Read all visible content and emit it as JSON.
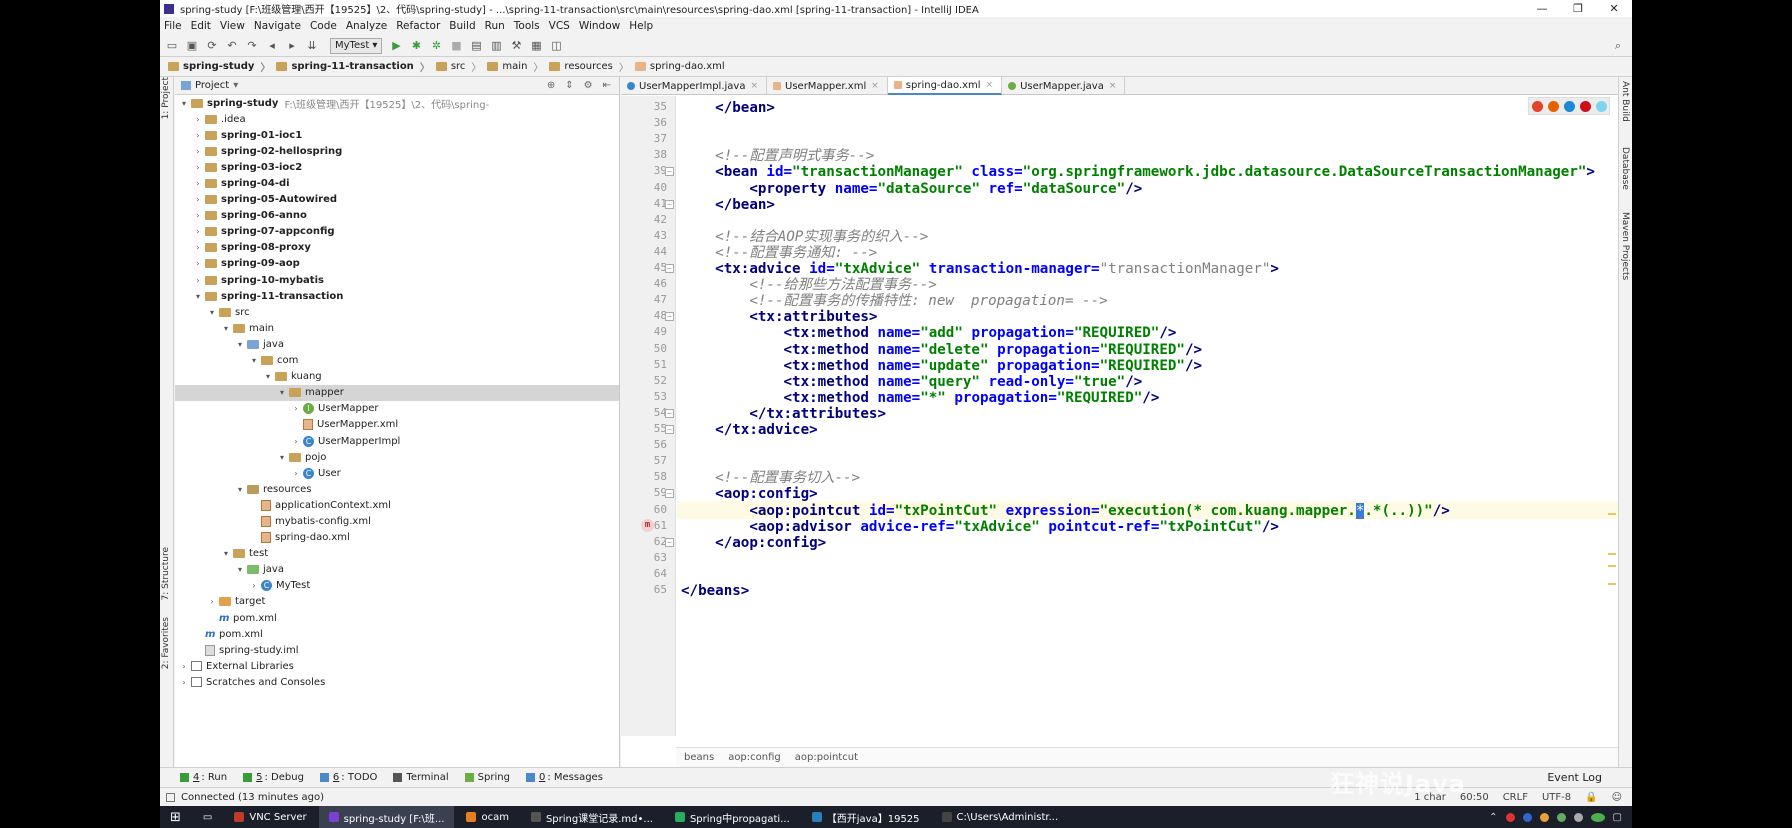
{
  "window": {
    "title": "spring-study [F:\\班级管理\\西开【19525】\\2、代码\\spring-study] - ...\\spring-11-transaction\\src\\main\\resources\\spring-dao.xml [spring-11-transaction] - IntelliJ IDEA",
    "minimize": "—",
    "maximize": "❐",
    "close": "✕"
  },
  "menu": [
    "File",
    "Edit",
    "View",
    "Navigate",
    "Code",
    "Analyze",
    "Refactor",
    "Build",
    "Run",
    "Tools",
    "VCS",
    "Window",
    "Help"
  ],
  "toolbar": {
    "run_config": "MyTest ▾"
  },
  "navbar": [
    "spring-study",
    "spring-11-transaction",
    "src",
    "main",
    "resources",
    "spring-dao.xml"
  ],
  "project": {
    "header": "Project",
    "tree": [
      {
        "label": "spring-study",
        "hint": "F:\\班级管理\\西开【19525】\\2、代码\\spring-",
        "depth": 0,
        "arrow": "open",
        "icon": "folder",
        "bold": true
      },
      {
        "label": ".idea",
        "depth": 1,
        "arrow": "closed",
        "icon": "folder"
      },
      {
        "label": "spring-01-ioc1",
        "depth": 1,
        "arrow": "closed",
        "icon": "folder",
        "bold": true
      },
      {
        "label": "spring-02-hellospring",
        "depth": 1,
        "arrow": "closed",
        "icon": "folder",
        "bold": true
      },
      {
        "label": "spring-03-ioc2",
        "depth": 1,
        "arrow": "closed",
        "icon": "folder",
        "bold": true
      },
      {
        "label": "spring-04-di",
        "depth": 1,
        "arrow": "closed",
        "icon": "folder",
        "bold": true
      },
      {
        "label": "spring-05-Autowired",
        "depth": 1,
        "arrow": "closed",
        "icon": "folder",
        "bold": true
      },
      {
        "label": "spring-06-anno",
        "depth": 1,
        "arrow": "closed",
        "icon": "folder",
        "bold": true
      },
      {
        "label": "spring-07-appconfig",
        "depth": 1,
        "arrow": "closed",
        "icon": "folder",
        "bold": true
      },
      {
        "label": "spring-08-proxy",
        "depth": 1,
        "arrow": "closed",
        "icon": "folder",
        "bold": true
      },
      {
        "label": "spring-09-aop",
        "depth": 1,
        "arrow": "closed",
        "icon": "folder",
        "bold": true
      },
      {
        "label": "spring-10-mybatis",
        "depth": 1,
        "arrow": "closed",
        "icon": "folder",
        "bold": true
      },
      {
        "label": "spring-11-transaction",
        "depth": 1,
        "arrow": "open",
        "icon": "folder",
        "bold": true
      },
      {
        "label": "src",
        "depth": 2,
        "arrow": "open",
        "icon": "folder"
      },
      {
        "label": "main",
        "depth": 3,
        "arrow": "open",
        "icon": "folder"
      },
      {
        "label": "java",
        "depth": 4,
        "arrow": "open",
        "icon": "src"
      },
      {
        "label": "com",
        "depth": 5,
        "arrow": "open",
        "icon": "folder"
      },
      {
        "label": "kuang",
        "depth": 6,
        "arrow": "open",
        "icon": "folder"
      },
      {
        "label": "mapper",
        "depth": 7,
        "arrow": "open",
        "icon": "folder",
        "selected": true
      },
      {
        "label": "UserMapper",
        "depth": 8,
        "arrow": "closed",
        "icon": "interface"
      },
      {
        "label": "UserMapper.xml",
        "depth": 8,
        "arrow": "none",
        "icon": "xml"
      },
      {
        "label": "UserMapperImpl",
        "depth": 8,
        "arrow": "closed",
        "icon": "class"
      },
      {
        "label": "pojo",
        "depth": 7,
        "arrow": "open",
        "icon": "folder"
      },
      {
        "label": "User",
        "depth": 8,
        "arrow": "closed",
        "icon": "class"
      },
      {
        "label": "resources",
        "depth": 4,
        "arrow": "open",
        "icon": "res"
      },
      {
        "label": "applicationContext.xml",
        "depth": 5,
        "arrow": "none",
        "icon": "xml"
      },
      {
        "label": "mybatis-config.xml",
        "depth": 5,
        "arrow": "none",
        "icon": "xml"
      },
      {
        "label": "spring-dao.xml",
        "depth": 5,
        "arrow": "none",
        "icon": "xml"
      },
      {
        "label": "test",
        "depth": 3,
        "arrow": "open",
        "icon": "folder"
      },
      {
        "label": "java",
        "depth": 4,
        "arrow": "open",
        "icon": "test"
      },
      {
        "label": "MyTest",
        "depth": 5,
        "arrow": "closed",
        "icon": "class"
      },
      {
        "label": "target",
        "depth": 2,
        "arrow": "closed",
        "icon": "target"
      },
      {
        "label": "pom.xml",
        "depth": 2,
        "arrow": "none",
        "icon": "maven"
      },
      {
        "label": "pom.xml",
        "depth": 1,
        "arrow": "none",
        "icon": "maven"
      },
      {
        "label": "spring-study.iml",
        "depth": 1,
        "arrow": "none",
        "icon": "file"
      },
      {
        "label": "External Libraries",
        "depth": 0,
        "arrow": "closed",
        "icon": "lib"
      },
      {
        "label": "Scratches and Consoles",
        "depth": 0,
        "arrow": "closed",
        "icon": "lib"
      }
    ]
  },
  "tabs": [
    {
      "label": "UserMapperImpl.java",
      "icon": "class",
      "active": false
    },
    {
      "label": "UserMapper.xml",
      "icon": "xml",
      "active": false
    },
    {
      "label": "spring-dao.xml",
      "icon": "xml",
      "active": true
    },
    {
      "label": "UserMapper.java",
      "icon": "interface",
      "active": false
    }
  ],
  "code": [
    {
      "n": 35,
      "t": [
        [
          "plain",
          "    "
        ],
        [
          "tag",
          "</bean>"
        ]
      ]
    },
    {
      "n": 36,
      "t": []
    },
    {
      "n": 37,
      "t": []
    },
    {
      "n": 38,
      "t": [
        [
          "plain",
          "    "
        ],
        [
          "cmt",
          "<!--配置声明式事务-->"
        ]
      ]
    },
    {
      "n": 39,
      "t": [
        [
          "plain",
          "    "
        ],
        [
          "tag",
          "<bean "
        ],
        [
          "attr",
          "id="
        ],
        [
          "val",
          "\"transactionManager\" "
        ],
        [
          "attr",
          "class="
        ],
        [
          "val",
          "\"org.springframework.jdbc.datasource.DataSourceTransactionManager\""
        ],
        [
          "tag",
          ">"
        ]
      ]
    },
    {
      "n": 40,
      "t": [
        [
          "plain",
          "        "
        ],
        [
          "tag",
          "<property "
        ],
        [
          "attr",
          "name="
        ],
        [
          "val",
          "\"dataSource\" "
        ],
        [
          "attr",
          "ref="
        ],
        [
          "val",
          "\"dataSource\""
        ],
        [
          "tag",
          "/>"
        ]
      ]
    },
    {
      "n": 41,
      "t": [
        [
          "plain",
          "    "
        ],
        [
          "tag",
          "</bean>"
        ]
      ]
    },
    {
      "n": 42,
      "t": []
    },
    {
      "n": 43,
      "t": [
        [
          "plain",
          "    "
        ],
        [
          "cmt",
          "<!--结合AOP实现事务的织入-->"
        ]
      ]
    },
    {
      "n": 44,
      "t": [
        [
          "plain",
          "    "
        ],
        [
          "cmt",
          "<!--配置事务通知: -->"
        ]
      ]
    },
    {
      "n": 45,
      "t": [
        [
          "plain",
          "    "
        ],
        [
          "tag",
          "<tx:advice "
        ],
        [
          "attr",
          "id="
        ],
        [
          "val",
          "\"txAdvice\" "
        ],
        [
          "attr",
          "transaction-manager="
        ],
        [
          "val2",
          "\"transactionManager\""
        ],
        [
          "tag",
          ">"
        ]
      ]
    },
    {
      "n": 46,
      "t": [
        [
          "plain",
          "        "
        ],
        [
          "cmt",
          "<!--给那些方法配置事务-->"
        ]
      ]
    },
    {
      "n": 47,
      "t": [
        [
          "plain",
          "        "
        ],
        [
          "cmt",
          "<!--配置事务的传播特性: new  propagation= -->"
        ]
      ]
    },
    {
      "n": 48,
      "t": [
        [
          "plain",
          "        "
        ],
        [
          "tag",
          "<tx:attributes>"
        ]
      ]
    },
    {
      "n": 49,
      "t": [
        [
          "plain",
          "            "
        ],
        [
          "tag",
          "<tx:method "
        ],
        [
          "attr",
          "name="
        ],
        [
          "val",
          "\"add\" "
        ],
        [
          "attr",
          "propagation="
        ],
        [
          "val",
          "\"REQUIRED\""
        ],
        [
          "tag",
          "/>"
        ]
      ]
    },
    {
      "n": 50,
      "t": [
        [
          "plain",
          "            "
        ],
        [
          "tag",
          "<tx:method "
        ],
        [
          "attr",
          "name="
        ],
        [
          "val",
          "\"delete\" "
        ],
        [
          "attr",
          "propagation="
        ],
        [
          "val",
          "\"REQUIRED\""
        ],
        [
          "tag",
          "/>"
        ]
      ]
    },
    {
      "n": 51,
      "t": [
        [
          "plain",
          "            "
        ],
        [
          "tag",
          "<tx:method "
        ],
        [
          "attr",
          "name="
        ],
        [
          "val",
          "\"update\" "
        ],
        [
          "attr",
          "propagation="
        ],
        [
          "val",
          "\"REQUIRED\""
        ],
        [
          "tag",
          "/>"
        ]
      ]
    },
    {
      "n": 52,
      "t": [
        [
          "plain",
          "            "
        ],
        [
          "tag",
          "<tx:method "
        ],
        [
          "attr",
          "name="
        ],
        [
          "val",
          "\"query\" "
        ],
        [
          "attr",
          "read-only="
        ],
        [
          "val",
          "\"true\""
        ],
        [
          "tag",
          "/>"
        ]
      ]
    },
    {
      "n": 53,
      "t": [
        [
          "plain",
          "            "
        ],
        [
          "tag",
          "<tx:method "
        ],
        [
          "attr",
          "name="
        ],
        [
          "val",
          "\"*\" "
        ],
        [
          "attr",
          "propagation="
        ],
        [
          "val",
          "\"REQUIRED\""
        ],
        [
          "tag",
          "/>"
        ]
      ]
    },
    {
      "n": 54,
      "t": [
        [
          "plain",
          "        "
        ],
        [
          "tag",
          "</tx:attributes>"
        ]
      ]
    },
    {
      "n": 55,
      "t": [
        [
          "plain",
          "    "
        ],
        [
          "tag",
          "</tx:advice>"
        ]
      ]
    },
    {
      "n": 56,
      "t": []
    },
    {
      "n": 57,
      "t": []
    },
    {
      "n": 58,
      "t": [
        [
          "plain",
          "    "
        ],
        [
          "cmt",
          "<!--配置事务切入-->"
        ]
      ]
    },
    {
      "n": 59,
      "t": [
        [
          "plain",
          "    "
        ],
        [
          "tag",
          "<aop:config>"
        ]
      ]
    },
    {
      "n": 60,
      "t": [
        [
          "plain",
          "        "
        ],
        [
          "tag",
          "<aop:pointcut "
        ],
        [
          "attr",
          "id="
        ],
        [
          "val",
          "\"txPointCut\" "
        ],
        [
          "attr",
          "expression="
        ],
        [
          "val",
          "\"execution(* com.kuang.mapper."
        ],
        [
          "cursor",
          "*"
        ],
        [
          "val",
          ".*(..))\""
        ],
        [
          "tag",
          "/>"
        ]
      ],
      "highlight": true
    },
    {
      "n": 61,
      "t": [
        [
          "plain",
          "        "
        ],
        [
          "tag",
          "<aop:advisor "
        ],
        [
          "attr",
          "advice-ref="
        ],
        [
          "val",
          "\"txAdvice\" "
        ],
        [
          "attr",
          "pointcut-ref="
        ],
        [
          "val",
          "\"txPointCut\""
        ],
        [
          "tag",
          "/>"
        ]
      ]
    },
    {
      "n": 62,
      "t": [
        [
          "plain",
          "    "
        ],
        [
          "tag",
          "</aop:config>"
        ]
      ]
    },
    {
      "n": 63,
      "t": []
    },
    {
      "n": 64,
      "t": []
    },
    {
      "n": 65,
      "t": [
        [
          "tag",
          "</beans>"
        ]
      ]
    }
  ],
  "breadcrumbs": [
    "beans",
    "aop:config",
    "aop:pointcut"
  ],
  "left_strip": [
    "1: Project",
    "7: Structure",
    "2: Favorites"
  ],
  "right_strip": [
    "Ant Build",
    "Database",
    "Maven Projects"
  ],
  "bottom_tools": [
    {
      "num": "4",
      "label": ": Run"
    },
    {
      "num": "5",
      "label": ": Debug"
    },
    {
      "num": "6",
      "label": ": TODO"
    },
    {
      "num": "",
      "label": "Terminal"
    },
    {
      "num": "",
      "label": "Spring"
    },
    {
      "num": "0",
      "label": ": Messages"
    }
  ],
  "status": {
    "message": "Connected (13 minutes ago)",
    "chars": "1 char",
    "position": "60:50",
    "line_sep": "CRLF",
    "encoding": "UTF-8",
    "event_log": "Event Log"
  },
  "watermark": "狂神说Java",
  "taskbar": {
    "items": [
      {
        "label": "VNC Server",
        "color": "#c0392b"
      },
      {
        "label": "spring-study [F:\\班...",
        "color": "#7b3fd1",
        "active": true
      },
      {
        "label": "ocam",
        "color": "#e67e22"
      },
      {
        "label": "Spring课堂记录.md•...",
        "color": "#555"
      },
      {
        "label": "Spring中propagati...",
        "color": "#27ae60"
      },
      {
        "label": "【西开java】19525",
        "color": "#2980b9"
      },
      {
        "label": "C:\\Users\\Administr...",
        "color": "#444"
      }
    ]
  },
  "colors": {
    "tag": "#000080",
    "attr": "#0000ff",
    "val": "#008000",
    "comment": "#808080",
    "accent": "#4a88c7"
  }
}
